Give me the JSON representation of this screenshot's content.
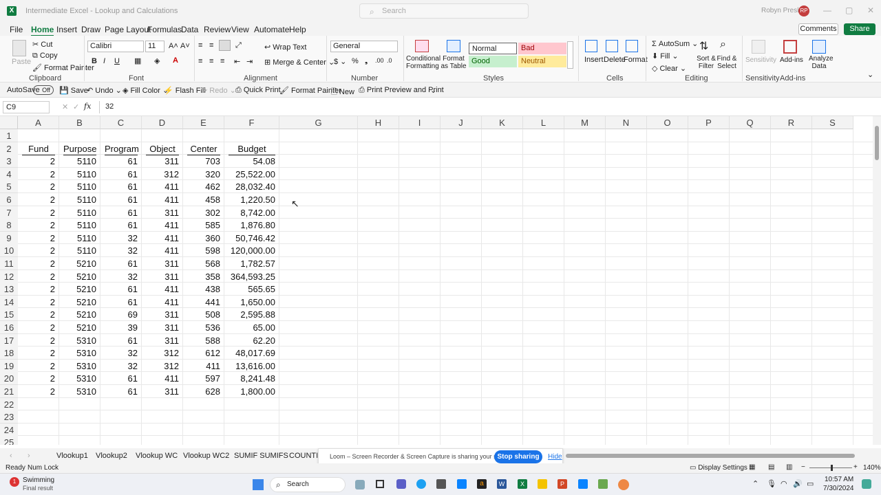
{
  "window": {
    "title": "Intermediate Excel - Lookup and Calculations",
    "search_placeholder": "Search",
    "user_name": "Robyn Presley",
    "user_initials": "RP"
  },
  "menu": {
    "tabs": [
      "File",
      "Home",
      "Insert",
      "Draw",
      "Page Layout",
      "Formulas",
      "Data",
      "Review",
      "View",
      "Automate",
      "Help"
    ],
    "comments": "Comments",
    "share": "Share"
  },
  "ribbon": {
    "clipboard": {
      "paste": "Paste",
      "cut": "Cut",
      "copy": "Copy",
      "format_painter": "Format Painter",
      "group": "Clipboard"
    },
    "font": {
      "name": "Calibri",
      "size": "11",
      "group": "Font"
    },
    "alignment": {
      "wrap": "Wrap Text",
      "merge": "Merge & Center",
      "group": "Alignment"
    },
    "number": {
      "format": "General",
      "group": "Number"
    },
    "styles": {
      "conditional": "Conditional Formatting",
      "format_table": "Format as Table",
      "normal": "Normal",
      "bad": "Bad",
      "good": "Good",
      "neutral": "Neutral",
      "group": "Styles"
    },
    "cells": {
      "insert": "Insert",
      "delete": "Delete",
      "format": "Format",
      "group": "Cells"
    },
    "editing": {
      "autosum": "AutoSum",
      "fill": "Fill",
      "clear": "Clear",
      "sort": "Sort & Filter",
      "find": "Find & Select",
      "group": "Editing"
    },
    "sensitivity": {
      "label": "Sensitivity",
      "group": "Sensitivity"
    },
    "addins": {
      "label": "Add-ins",
      "group": "Add-ins"
    },
    "analyze": {
      "label": "Analyze Data"
    }
  },
  "qat": {
    "autosave": "AutoSave",
    "toggle": "Off",
    "save": "Save",
    "undo": "Undo",
    "fill_color": "Fill Color",
    "flash_fill": "Flash Fill",
    "redo": "Redo",
    "quick_print": "Quick Print",
    "format_painter": "Format Painter",
    "new": "New",
    "print_preview": "Print Preview and Print"
  },
  "formula_bar": {
    "name_box": "C9",
    "fx": "fx",
    "value": "32"
  },
  "columns": [
    "A",
    "B",
    "C",
    "D",
    "E",
    "F",
    "G",
    "H",
    "I",
    "J",
    "K",
    "L",
    "M",
    "N",
    "O",
    "P",
    "Q",
    "R",
    "S"
  ],
  "rows": [
    "1",
    "2",
    "3",
    "4",
    "5",
    "6",
    "7",
    "8",
    "9",
    "10",
    "11",
    "12",
    "13",
    "14",
    "15",
    "16",
    "17",
    "18",
    "19",
    "20",
    "21",
    "22",
    "23",
    "24",
    "25"
  ],
  "table": {
    "headers": [
      "Fund",
      "Purpose",
      "Program",
      "Object",
      "Center",
      "Budget"
    ],
    "data": [
      [
        "2",
        "5110",
        "61",
        "311",
        "703",
        "54.08"
      ],
      [
        "2",
        "5110",
        "61",
        "312",
        "320",
        "25,522.00"
      ],
      [
        "2",
        "5110",
        "61",
        "411",
        "462",
        "28,032.40"
      ],
      [
        "2",
        "5110",
        "61",
        "411",
        "458",
        "1,220.50"
      ],
      [
        "2",
        "5110",
        "61",
        "311",
        "302",
        "8,742.00"
      ],
      [
        "2",
        "5110",
        "61",
        "411",
        "585",
        "1,876.80"
      ],
      [
        "2",
        "5110",
        "32",
        "411",
        "360",
        "50,746.42"
      ],
      [
        "2",
        "5110",
        "32",
        "411",
        "598",
        "120,000.00"
      ],
      [
        "2",
        "5210",
        "61",
        "311",
        "568",
        "1,782.57"
      ],
      [
        "2",
        "5210",
        "32",
        "311",
        "358",
        "364,593.25"
      ],
      [
        "2",
        "5210",
        "61",
        "411",
        "438",
        "565.65"
      ],
      [
        "2",
        "5210",
        "61",
        "411",
        "441",
        "1,650.00"
      ],
      [
        "2",
        "5210",
        "69",
        "311",
        "508",
        "2,595.88"
      ],
      [
        "2",
        "5210",
        "39",
        "311",
        "536",
        "65.00"
      ],
      [
        "2",
        "5310",
        "61",
        "311",
        "588",
        "62.20"
      ],
      [
        "2",
        "5310",
        "32",
        "312",
        "612",
        "48,017.69"
      ],
      [
        "2",
        "5310",
        "32",
        "312",
        "411",
        "13,616.00"
      ],
      [
        "2",
        "5310",
        "61",
        "411",
        "597",
        "8,241.48"
      ],
      [
        "2",
        "5310",
        "61",
        "311",
        "628",
        "1,800.00"
      ]
    ]
  },
  "sheets": [
    "Vlookup1",
    "Vlookup2",
    "Vlookup WC",
    "Vlookup WC2",
    "SUMIF SUMIFS",
    "COUNTIF"
  ],
  "loom": {
    "message": "Loom – Screen Recorder & Screen Capture is sharing your screen.",
    "stop": "Stop sharing",
    "hide": "Hide"
  },
  "status": {
    "ready": "Ready",
    "numlock": "Num Lock",
    "display": "Display Settings",
    "zoom": "140%"
  },
  "taskbar": {
    "weather_title": "Swimming",
    "weather_sub": "Final result",
    "search": "Search",
    "time": "10:57 AM",
    "date": "7/30/2024"
  },
  "colors": {
    "excel_green": "#107c41",
    "share_green": "#107c41",
    "bad_bg": "#ffc7ce",
    "good_bg": "#c6efce",
    "neutral_bg": "#ffeb9c",
    "loom_blue": "#1a73e8"
  }
}
